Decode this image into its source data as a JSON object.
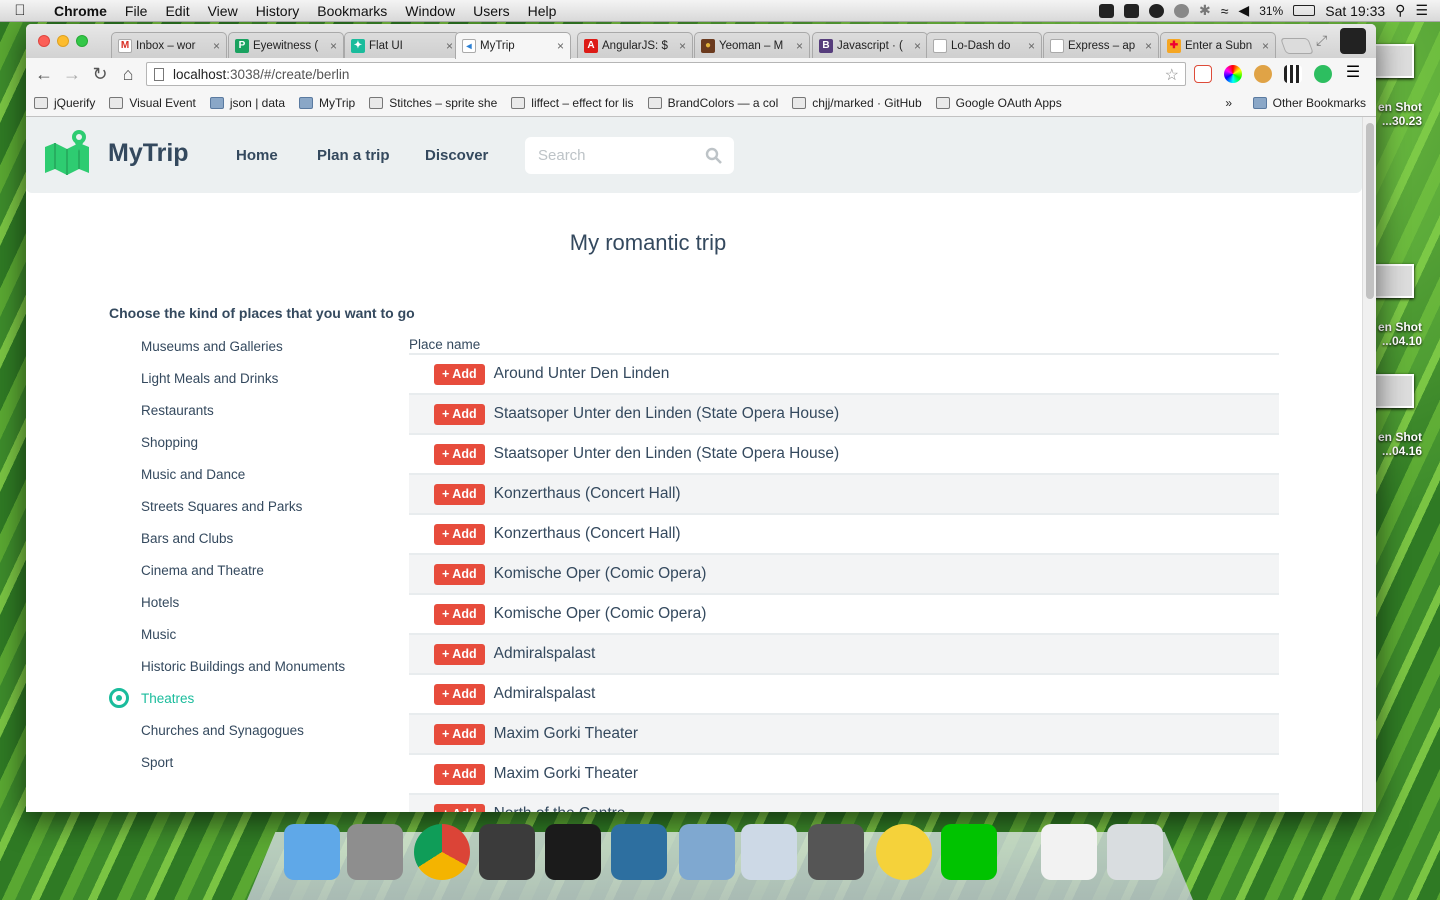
{
  "menubar": {
    "app": "Chrome",
    "items": [
      "File",
      "Edit",
      "View",
      "History",
      "Bookmarks",
      "Window",
      "Users",
      "Help"
    ],
    "battery": "31%",
    "clock": "Sat 19:33"
  },
  "desktop": {
    "labels": [
      {
        "line1": "en Shot",
        "line2": "...30.23"
      },
      {
        "line1": "en Shot",
        "line2": "...04.10"
      },
      {
        "line1": "en Shot",
        "line2": "...04.16"
      }
    ]
  },
  "tabs": [
    {
      "title": "Inbox – wor",
      "fav": "M",
      "color": "#ffffff",
      "fg": "#d93025"
    },
    {
      "title": "Eyewitness (",
      "fav": "P",
      "color": "#1aa260",
      "fg": "#fff"
    },
    {
      "title": "Flat UI",
      "fav": "✦",
      "color": "#1abc9c",
      "fg": "#fff"
    },
    {
      "title": "MyTrip",
      "fav": "◂",
      "color": "#ffffff",
      "fg": "#2a7fd4",
      "active": true
    },
    {
      "title": "AngularJS: $",
      "fav": "A",
      "color": "#dd1b16",
      "fg": "#fff"
    },
    {
      "title": "Yeoman – M",
      "fav": "●",
      "color": "#6b3a1e",
      "fg": "#e2b23a"
    },
    {
      "title": "Javascript · (",
      "fav": "B",
      "color": "#563d7c",
      "fg": "#fff"
    },
    {
      "title": "Lo-Dash do",
      "fav": "",
      "color": "#ffffff",
      "fg": "#777"
    },
    {
      "title": "Express – ap",
      "fav": "",
      "color": "#ffffff",
      "fg": "#777"
    },
    {
      "title": "Enter a Subn",
      "fav": "✚",
      "color": "#f5a623",
      "fg": "#e03"
    }
  ],
  "toolbar": {
    "url_host": "localhost",
    "url_rest": ":3038/#/create/berlin"
  },
  "bookmarks": [
    {
      "label": "jQuerify",
      "type": "page"
    },
    {
      "label": "Visual Event",
      "type": "page"
    },
    {
      "label": "json | data",
      "type": "folder"
    },
    {
      "label": "MyTrip",
      "type": "folder"
    },
    {
      "label": "Stitches – sprite she",
      "type": "page"
    },
    {
      "label": "liffect – effect for lis",
      "type": "page"
    },
    {
      "label": "BrandColors — a col",
      "type": "page",
      "prefix": "BC"
    },
    {
      "label": "chjj/marked · GitHub",
      "type": "page"
    },
    {
      "label": "Google OAuth Apps",
      "type": "page"
    }
  ],
  "bookmarks_more": "»",
  "bookmarks_other": "Other Bookmarks",
  "app": {
    "brand": "MyTrip",
    "nav": [
      "Home",
      "Plan a trip",
      "Discover"
    ],
    "search_placeholder": "Search",
    "trip_title": "My romantic trip",
    "choose_label": "Choose the kind of places that you want to go",
    "categories": [
      "Museums and Galleries",
      "Light Meals and Drinks",
      "Restaurants",
      "Shopping",
      "Music and Dance",
      "Streets Squares and Parks",
      "Bars and Clubs",
      "Cinema and Theatre",
      "Hotels",
      "Music",
      "Historic Buildings and Monuments",
      "Theatres",
      "Churches and Synagogues",
      "Sport"
    ],
    "selected_category": "Theatres",
    "table_header": "Place name",
    "add_label": "+ Add",
    "places": [
      "Around Unter Den Linden",
      "Staatsoper Unter den Linden (State Opera House)",
      "Staatsoper Unter den Linden (State Opera House)",
      "Konzerthaus (Concert Hall)",
      "Konzerthaus (Concert Hall)",
      "Komische Oper (Comic Opera)",
      "Komische Oper (Comic Opera)",
      "Admiralspalast",
      "Admiralspalast",
      "Maxim Gorki Theater",
      "Maxim Gorki Theater",
      "North of the Centre"
    ]
  },
  "colors": {
    "accent": "#1abc9c",
    "add": "#e74c3c",
    "text": "#34495e",
    "navbg": "#ecf0f1"
  }
}
